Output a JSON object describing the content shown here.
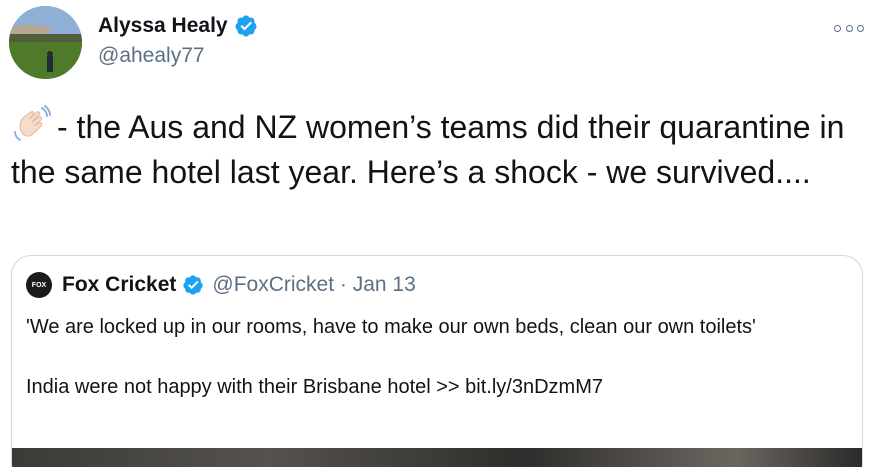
{
  "author": {
    "name": "Alyssa Healy",
    "handle": "@ahealy77",
    "verified": true
  },
  "tweet": {
    "emoji": "waving-hand-icon",
    "text": "- the Aus and NZ women’s teams did their quarantine in the same hotel last year. Here’s a shock - we survived...."
  },
  "quoted": {
    "logo_text": "FOX",
    "name": "Fox Cricket",
    "meta": "@FoxCricket · Jan 13",
    "verified": true,
    "line1": "'We are locked up in our rooms, have to make our own beds, clean our own toilets'",
    "line2": "India were not happy with their Brisbane hotel >> bit.ly/3nDzmM7"
  },
  "colors": {
    "verified_blue": "#1da1f2",
    "secondary_text": "#5b7083",
    "border": "#cfd9de"
  }
}
